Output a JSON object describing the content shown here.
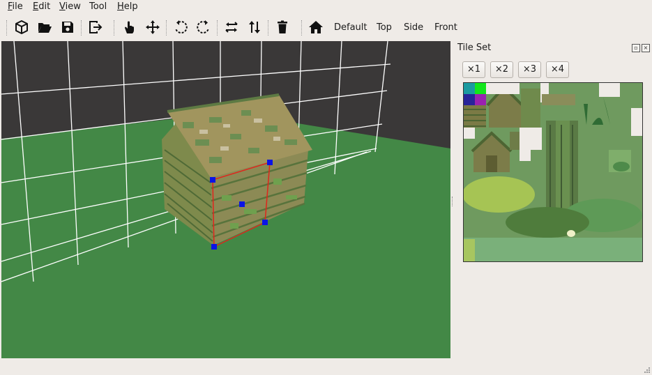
{
  "menu": {
    "file": {
      "u": "F",
      "rest": "ile"
    },
    "edit": {
      "u": "E",
      "rest": "dit"
    },
    "view": {
      "u": "V",
      "rest": "iew"
    },
    "tool": {
      "u": "",
      "rest": "Tool"
    },
    "help": {
      "u": "H",
      "rest": "elp"
    }
  },
  "toolbar": {
    "icons": [
      "new-mesh-icon",
      "open-folder-icon",
      "save-icon",
      "export-icon",
      "hand-icon",
      "move-icon",
      "rotate-ccw-icon",
      "rotate-cw-icon",
      "flip-horizontal-icon",
      "flip-vertical-icon",
      "delete-icon",
      "home-icon"
    ],
    "views": [
      "Default",
      "Top",
      "Side",
      "Front"
    ]
  },
  "tileset_panel": {
    "title": "Tile Set",
    "zoom_buttons": [
      "×1",
      "×2",
      "×3",
      "×4"
    ]
  },
  "colors": {
    "window_bg": "#efebe7",
    "viewport_bg": "#3a3838",
    "ground": "#438846",
    "grid_line": "#ffffff",
    "selection_edge": "#e0251c",
    "selection_handle": "#0a14e6"
  }
}
